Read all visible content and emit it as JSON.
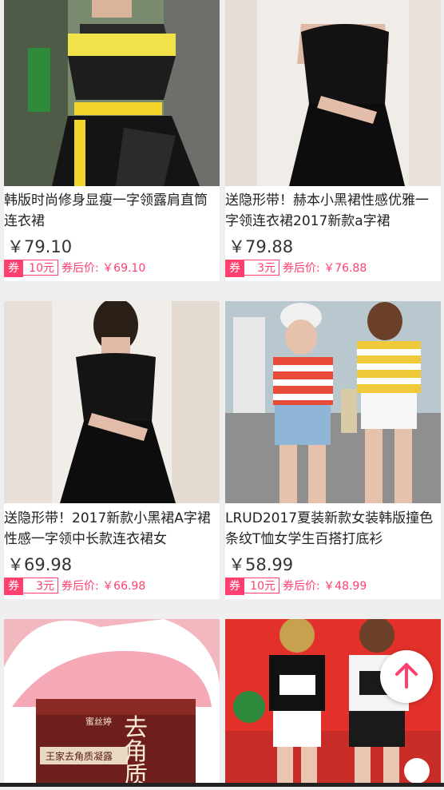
{
  "products": [
    {
      "title": "韩版时尚修身显瘦一字领露肩直筒连衣裙",
      "price": "￥79.10",
      "coupon_tag": "券",
      "coupon_value": "10元",
      "after_price": "券后价: ￥69.10"
    },
    {
      "title": "送隐形带！赫本小黑裙性感优雅一字领连衣裙2017新款a字裙",
      "price": "￥79.88",
      "coupon_tag": "券",
      "coupon_value": "3元",
      "after_price": "券后价: ￥76.88"
    },
    {
      "title": "送隐形带！2017新款小黑裙A字裙性感一字领中长款连衣裙女",
      "price": "￥69.98",
      "coupon_tag": "券",
      "coupon_value": "3元",
      "after_price": "券后价: ￥66.98"
    },
    {
      "title": "LRUD2017夏装新款女装韩版撞色条纹T恤女学生百搭打底衫",
      "price": "￥58.99",
      "coupon_tag": "券",
      "coupon_value": "10元",
      "after_price": "券后价: ￥48.99"
    },
    {
      "title": "",
      "price": "",
      "coupon_tag": "",
      "coupon_value": "",
      "after_price": "",
      "image_text_brand": "蜜丝婷",
      "image_text_product": "去角质",
      "image_text_label": "王家去角质凝露"
    },
    {
      "title": "",
      "price": "",
      "coupon_tag": "",
      "coupon_value": "",
      "after_price": ""
    }
  ],
  "colors": {
    "accent": "#ff3f6e",
    "price_text": "#333333",
    "background": "#efefef"
  },
  "icons": {
    "back_to_top": "arrow-up-icon"
  }
}
